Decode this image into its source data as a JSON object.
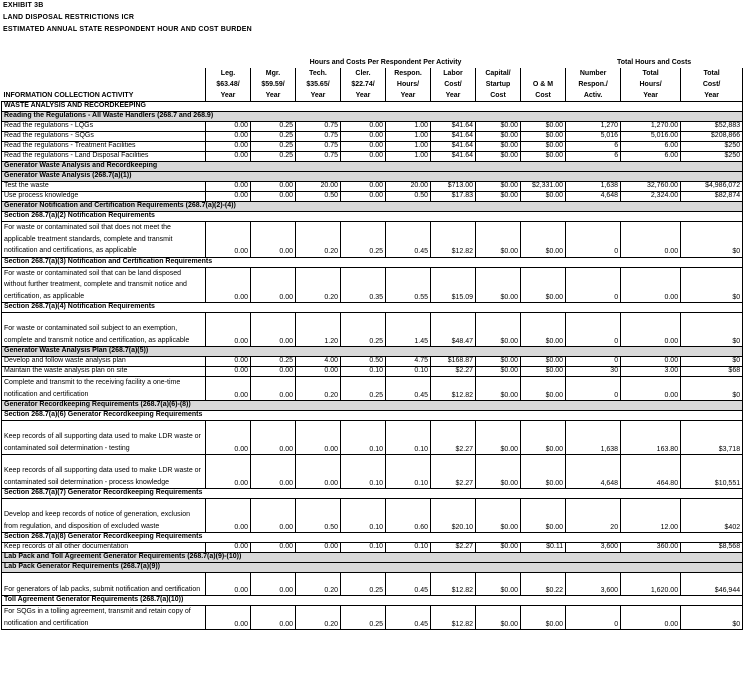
{
  "header": {
    "exhibit": "EXHIBIT 3B",
    "title": "LAND DISPOSAL RESTRICTIONS ICR",
    "subtitle": "ESTIMATED ANNUAL STATE RESPONDENT HOUR AND COST BURDEN"
  },
  "groups": {
    "per_respondent": "Hours and Costs Per Respondent Per Activity",
    "total": "Total Hours and Costs"
  },
  "columns": {
    "activity": "INFORMATION COLLECTION ACTIVITY",
    "leg": [
      "Leg.",
      "$63.48/",
      "Year"
    ],
    "mgr": [
      "Mgr.",
      "$59.59/",
      "Year"
    ],
    "tech": [
      "Tech.",
      "$35.65/",
      "Year"
    ],
    "cler": [
      "Cler.",
      "$22.74/",
      "Year"
    ],
    "respon": [
      "Respon.",
      "Hours/",
      "Year"
    ],
    "labor": [
      "Labor",
      "Cost/",
      "Year"
    ],
    "capital": [
      "Capital/",
      "Startup",
      "Cost"
    ],
    "om": [
      "",
      "O & M",
      "Cost"
    ],
    "number": [
      "Number",
      "Respon./",
      "Activ."
    ],
    "total_hours": [
      "Total",
      "Hours/",
      "Year"
    ],
    "total_cost": [
      "Total",
      "Cost/",
      "Year"
    ]
  },
  "rows": [
    {
      "type": "sub",
      "text": "WASTE ANALYSIS AND RECORDKEEPING"
    },
    {
      "type": "sec",
      "text": "Reading the Regulations - All Waste Handlers (268.7 and 268.9)"
    },
    {
      "type": "r",
      "act": "Read the regulations - LQGs",
      "v": [
        "0.00",
        "0.25",
        "0.75",
        "0.00",
        "1.00",
        "$41.64",
        "$0.00",
        "$0.00",
        "1,270",
        "1,270.00",
        "$52,883"
      ]
    },
    {
      "type": "r",
      "act": "Read the regulations - SQGs",
      "v": [
        "0.00",
        "0.25",
        "0.75",
        "0.00",
        "1.00",
        "$41.64",
        "$0.00",
        "$0.00",
        "5,016",
        "5,016.00",
        "$208,866"
      ]
    },
    {
      "type": "r",
      "act": "Read the regulations - Treatment Facilities",
      "v": [
        "0.00",
        "0.25",
        "0.75",
        "0.00",
        "1.00",
        "$41.64",
        "$0.00",
        "$0.00",
        "6",
        "6.00",
        "$250"
      ]
    },
    {
      "type": "r",
      "act": "Read the regulations - Land Disposal Facilities",
      "v": [
        "0.00",
        "0.25",
        "0.75",
        "0.00",
        "1.00",
        "$41.64",
        "$0.00",
        "$0.00",
        "6",
        "6.00",
        "$250"
      ]
    },
    {
      "type": "sec",
      "text": "Generator Waste Analysis and Recordkeeping"
    },
    {
      "type": "sec",
      "text": "Generator Waste Analysis (268.7(a)(1))"
    },
    {
      "type": "r",
      "act": "Test the waste",
      "v": [
        "0.00",
        "0.00",
        "20.00",
        "0.00",
        "20.00",
        "$713.00",
        "$0.00",
        "$2,331.00",
        "1,638",
        "32,760.00",
        "$4,986,072"
      ]
    },
    {
      "type": "r",
      "act": "Use process knowledge",
      "v": [
        "0.00",
        "0.00",
        "0.50",
        "0.00",
        "0.50",
        "$17.83",
        "$0.00",
        "$0.00",
        "4,648",
        "2,324.00",
        "$82,874"
      ]
    },
    {
      "type": "sec",
      "text": "Generator Notification and Certification Requirements (268.7(a)(2)-(4))"
    },
    {
      "type": "sub",
      "text": "Section 268.7(a)(2) Notification Requirements"
    },
    {
      "type": "ml",
      "h": 34,
      "act": "For waste or contaminated soil that does not meet the applicable treatment standards, complete and transmit notification and certifications, as applicable",
      "v": [
        "0.00",
        "0.00",
        "0.20",
        "0.25",
        "0.45",
        "$12.82",
        "$0.00",
        "$0.00",
        "0",
        "0.00",
        "$0"
      ]
    },
    {
      "type": "sub",
      "text": "Section 268.7(a)(3) Notification and Certification Requirements"
    },
    {
      "type": "ml",
      "h": 34,
      "act": "For waste or contaminated soil that can be land disposed without further treatment, complete and transmit notice and certification, as applicable",
      "v": [
        "0.00",
        "0.00",
        "0.20",
        "0.35",
        "0.55",
        "$15.09",
        "$0.00",
        "$0.00",
        "0",
        "0.00",
        "$0"
      ]
    },
    {
      "type": "sub",
      "text": "Section 268.7(a)(4) Notification Requirements"
    },
    {
      "type": "ml",
      "h": 34,
      "act": "For waste or contaminated soil subject to an exemption, complete and transmit notice and certification, as applicable",
      "v": [
        "0.00",
        "0.00",
        "1.20",
        "0.25",
        "1.45",
        "$48.47",
        "$0.00",
        "$0.00",
        "0",
        "0.00",
        "$0"
      ]
    },
    {
      "type": "sec",
      "text": "Generator Waste Analysis Plan (268.7(a)(5))"
    },
    {
      "type": "r",
      "act": "Develop and follow waste analysis plan",
      "v": [
        "0.00",
        "0.25",
        "4.00",
        "0.50",
        "4.75",
        "$168.87",
        "$0.00",
        "$0.00",
        "0",
        "0.00",
        "$0"
      ]
    },
    {
      "type": "r",
      "act": "Maintain the waste analysis plan on site",
      "v": [
        "0.00",
        "0.00",
        "0.00",
        "0.10",
        "0.10",
        "$2.27",
        "$0.00",
        "$0.00",
        "30",
        "3.00",
        "$68"
      ]
    },
    {
      "type": "ml",
      "h": 23,
      "act": "Complete and transmit to the receiving facility a one-time notification and certification",
      "v": [
        "0.00",
        "0.00",
        "0.20",
        "0.25",
        "0.45",
        "$12.82",
        "$0.00",
        "$0.00",
        "0",
        "0.00",
        "$0"
      ]
    },
    {
      "type": "sec",
      "text": "Generator Recordkeeping Requirements (268.7(a)(6)-(8))"
    },
    {
      "type": "sub",
      "text": "Section 268.7(a)(6) Generator Recordkeeping Requirements"
    },
    {
      "type": "ml",
      "h": 34,
      "act": "Keep records of all supporting data used to make LDR waste or contaminated soil determination - testing",
      "v": [
        "0.00",
        "0.00",
        "0.00",
        "0.10",
        "0.10",
        "$2.27",
        "$0.00",
        "$0.00",
        "1,638",
        "163.80",
        "$3,718"
      ]
    },
    {
      "type": "ml",
      "h": 34,
      "act": "Keep records of all supporting data used to make LDR waste or contaminated soil determination - process knowledge",
      "v": [
        "0.00",
        "0.00",
        "0.00",
        "0.10",
        "0.10",
        "$2.27",
        "$0.00",
        "$0.00",
        "4,648",
        "464.80",
        "$10,551"
      ]
    },
    {
      "type": "sub",
      "text": "Section 268.7(a)(7) Generator Recordkeeping Requirements"
    },
    {
      "type": "ml",
      "h": 34,
      "act": "Develop and keep records of notice of generation, exclusion from regulation, and disposition of excluded waste",
      "v": [
        "0.00",
        "0.00",
        "0.50",
        "0.10",
        "0.60",
        "$20.10",
        "$0.00",
        "$0.00",
        "20",
        "12.00",
        "$402"
      ]
    },
    {
      "type": "sub",
      "text": "Section 268.7(a)(8) Generator Recordkeeping Requirements"
    },
    {
      "type": "r",
      "act": "Keep records of all other documentation",
      "v": [
        "0.00",
        "0.00",
        "0.00",
        "0.10",
        "0.10",
        "$2.27",
        "$0.00",
        "$0.11",
        "3,600",
        "360.00",
        "$8,568"
      ]
    },
    {
      "type": "sec",
      "text": "Lab Pack and Toll Agreement Generator Requirements (268.7(a)(9)-(10))"
    },
    {
      "type": "sec",
      "text": "Lab Pack Generator Requirements (268.7(a)(9))"
    },
    {
      "type": "ml",
      "h": 23,
      "act": "For generators of lab packs, submit notification and certification",
      "v": [
        "0.00",
        "0.00",
        "0.20",
        "0.25",
        "0.45",
        "$12.82",
        "$0.00",
        "$0.22",
        "3,600",
        "1,620.00",
        "$46,944"
      ]
    },
    {
      "type": "sub",
      "text": "Toll Agreement Generator Requirements (268.7(a)(10))"
    },
    {
      "type": "ml",
      "h": 23,
      "act": "For SQGs in a tolling agreement, transmit and retain copy of notification and certification",
      "v": [
        "0.00",
        "0.00",
        "0.20",
        "0.25",
        "0.45",
        "$12.82",
        "$0.00",
        "$0.00",
        "0",
        "0.00",
        "$0"
      ]
    }
  ]
}
